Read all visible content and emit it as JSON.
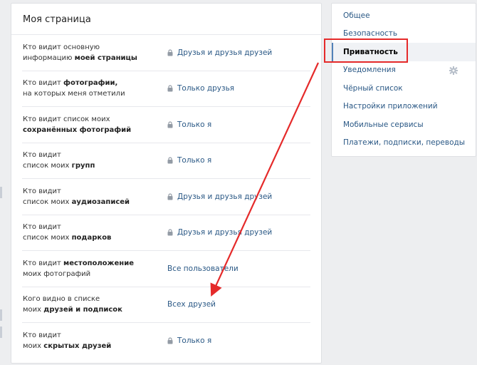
{
  "panel": {
    "title": "Моя страница",
    "rows": [
      {
        "label_l1": [
          "Кто видит основную",
          ""
        ],
        "label_l2": [
          "информацию ",
          "моей страницы"
        ],
        "value": "Друзья и друзья друзей",
        "lock": true
      },
      {
        "label_l1": [
          "Кто видит ",
          "фотографии,"
        ],
        "label_l2": [
          "на которых меня отметили",
          ""
        ],
        "value": "Только друзья",
        "lock": true
      },
      {
        "label_l1": [
          "Кто видит список моих",
          ""
        ],
        "label_l2": [
          "",
          "сохранённых фотографий"
        ],
        "value": "Только я",
        "lock": true
      },
      {
        "label_l1": [
          "Кто видит",
          ""
        ],
        "label_l2": [
          "список моих ",
          "групп"
        ],
        "value": "Только я",
        "lock": true
      },
      {
        "label_l1": [
          "Кто видит",
          ""
        ],
        "label_l2": [
          "список моих ",
          "аудиозаписей"
        ],
        "value": "Друзья и друзья друзей",
        "lock": true
      },
      {
        "label_l1": [
          "Кто видит",
          ""
        ],
        "label_l2": [
          "список моих ",
          "подарков"
        ],
        "value": "Друзья и друзья друзей",
        "lock": true
      },
      {
        "label_l1": [
          "Кто видит ",
          "местоположение"
        ],
        "label_l2": [
          "моих фотографий",
          ""
        ],
        "value": "Все пользователи",
        "lock": false
      },
      {
        "label_l1": [
          "Кого видно в списке",
          ""
        ],
        "label_l2": [
          "моих ",
          "друзей и подписок"
        ],
        "value": "Всех друзей",
        "lock": false
      },
      {
        "label_l1": [
          "Кто видит",
          ""
        ],
        "label_l2": [
          "моих ",
          "скрытых друзей"
        ],
        "value": "Только я",
        "lock": true
      }
    ]
  },
  "sidebar": {
    "items": [
      {
        "label": "Общее",
        "active": false
      },
      {
        "label": "Безопасность",
        "active": false
      },
      {
        "label": "Приватность",
        "active": true
      },
      {
        "label": "Уведомления",
        "active": false,
        "gear": true
      },
      {
        "label": "Чёрный список",
        "active": false
      },
      {
        "label": "Настройки приложений",
        "active": false
      },
      {
        "label": "Мобильные сервисы",
        "active": false
      },
      {
        "label": "Платежи, подписки, переводы",
        "active": false
      }
    ]
  },
  "colors": {
    "link": "#2a5885",
    "annotation": "#e52a2a",
    "accent": "#5181b8"
  },
  "icons": {
    "lock": "lock-icon",
    "gear": "gear-icon"
  }
}
